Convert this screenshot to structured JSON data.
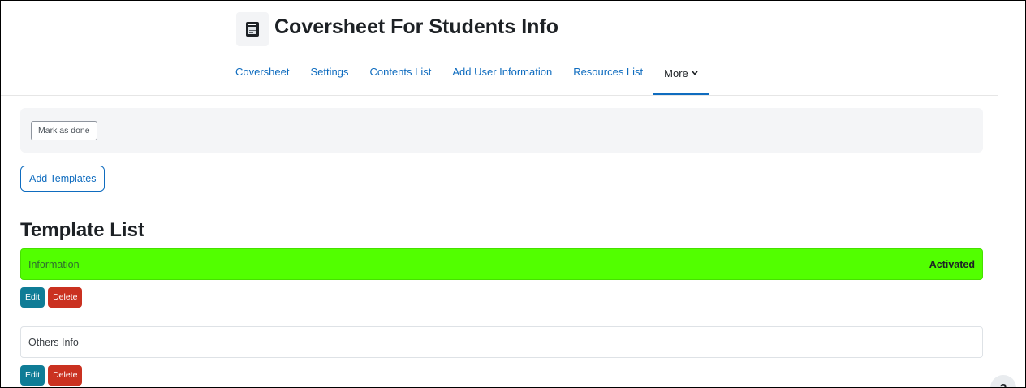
{
  "header": {
    "title": "Coversheet For Students Info",
    "icon": "document-icon"
  },
  "nav": {
    "items": [
      {
        "label": "Coversheet"
      },
      {
        "label": "Settings"
      },
      {
        "label": "Contents List"
      },
      {
        "label": "Add User Information"
      },
      {
        "label": "Resources List"
      },
      {
        "label": "More"
      }
    ],
    "active": "More"
  },
  "completion": {
    "mark_done_label": "Mark as done"
  },
  "actions": {
    "add_templates_label": "Add Templates"
  },
  "template_list": {
    "title": "Template List",
    "items": [
      {
        "name": "Information",
        "status": "Activated",
        "edit_label": "Edit",
        "delete_label": "Delete"
      },
      {
        "name": "Others Info",
        "status": "",
        "edit_label": "Edit",
        "delete_label": "Delete"
      }
    ]
  },
  "help": {
    "label": "?"
  },
  "colors": {
    "link": "#0f6cbf",
    "activated_row": "#52ff00",
    "edit_button": "#0f7c96",
    "delete_button": "#ca3120"
  }
}
